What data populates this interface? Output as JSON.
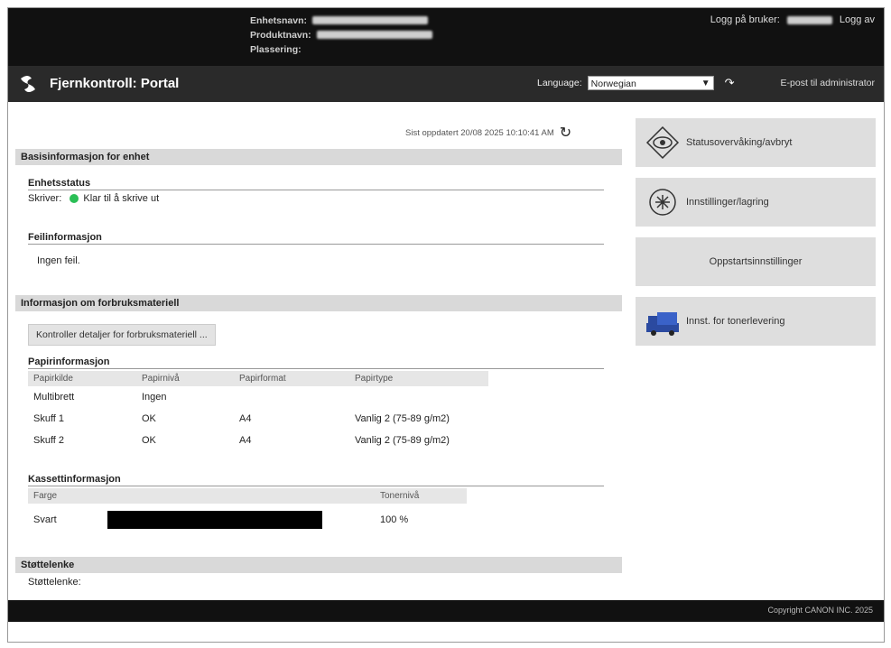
{
  "header": {
    "device_name_label": "Enhetsnavn:",
    "product_name_label": "Produktnavn:",
    "location_label": "Plassering:",
    "login_label": "Logg på bruker:",
    "logout": "Logg av"
  },
  "titlebar": {
    "title": "Fjernkontroll: Portal",
    "language_label": "Language:",
    "language_value": "Norwegian",
    "admin_link": "E-post til administrator"
  },
  "main": {
    "last_updated": "Sist oppdatert 20/08 2025 10:10:41 AM",
    "basic_section": "Basisinformasjon for enhet",
    "device_status_heading": "Enhetsstatus",
    "printer_label": "Skriver:",
    "printer_status": "Klar til å skrive ut",
    "error_heading": "Feilinformasjon",
    "error_text": "Ingen feil.",
    "consumables_section": "Informasjon om forbruksmateriell",
    "check_button": "Kontroller detaljer for forbruksmateriell ...",
    "paper_heading": "Papirinformasjon",
    "paper_columns": [
      "Papirkilde",
      "Papirnivå",
      "Papirformat",
      "Papirtype"
    ],
    "paper_rows": [
      [
        "Multibrett",
        "Ingen",
        "",
        ""
      ],
      [
        "Skuff 1",
        "OK",
        "A4",
        "Vanlig 2 (75-89 g/m2)"
      ],
      [
        "Skuff 2",
        "OK",
        "A4",
        "Vanlig 2 (75-89 g/m2)"
      ]
    ],
    "cassette_heading": "Kassettinformasjon",
    "cassette_columns": [
      "Farge",
      "Tonernivå"
    ],
    "cassette_rows": [
      [
        "Svart",
        "100 %"
      ]
    ],
    "toner_level_fraction": 1.0,
    "support_section": "Støttelenke",
    "support_label": "Støttelenke:"
  },
  "sidebar": {
    "items": [
      {
        "label": "Statusovervåking/avbryt",
        "icon": "eye-icon"
      },
      {
        "label": "Innstillinger/lagring",
        "icon": "settings-icon"
      },
      {
        "label": "Oppstartsinnstillinger",
        "icon": ""
      },
      {
        "label": "Innst. for tonerlevering",
        "icon": "truck-icon"
      }
    ]
  },
  "footer": {
    "copyright": "Copyright CANON INC. 2025"
  }
}
